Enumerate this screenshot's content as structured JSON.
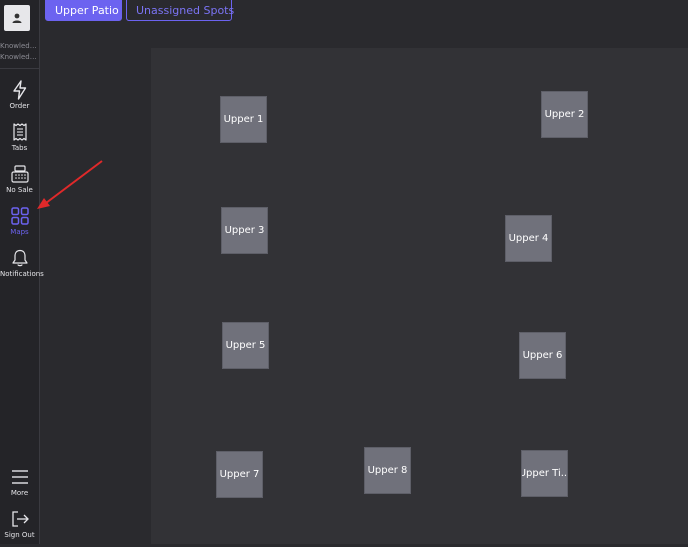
{
  "sidebar": {
    "user_line1": "Knowled…",
    "user_line2": "Knowled…",
    "items": [
      {
        "label": "Order",
        "icon": "bolt-icon"
      },
      {
        "label": "Tabs",
        "icon": "receipt-icon"
      },
      {
        "label": "No Sale",
        "icon": "cash-register-icon"
      },
      {
        "label": "Maps",
        "icon": "grid-icon",
        "active": true
      },
      {
        "label": "Notifications",
        "icon": "bell-icon"
      },
      {
        "label": "More",
        "icon": "hamburger-icon"
      },
      {
        "label": "Sign Out",
        "icon": "sign-out-icon"
      }
    ]
  },
  "tabs": {
    "primary": "Upper Patio",
    "secondary": "Unassigned Spots"
  },
  "spots": [
    {
      "label": "Upper 1"
    },
    {
      "label": "Upper 2"
    },
    {
      "label": "Upper 3"
    },
    {
      "label": "Upper 4"
    },
    {
      "label": "Upper 5"
    },
    {
      "label": "Upper 6"
    },
    {
      "label": "Upper 7"
    },
    {
      "label": "Upper 8"
    },
    {
      "label": "Upper Ti..."
    }
  ],
  "colors": {
    "accent": "#6c63f0",
    "annotation_arrow": "#e0292a",
    "spot": "#70717b",
    "canvas": "#323236",
    "background": "#2a2a2e"
  }
}
